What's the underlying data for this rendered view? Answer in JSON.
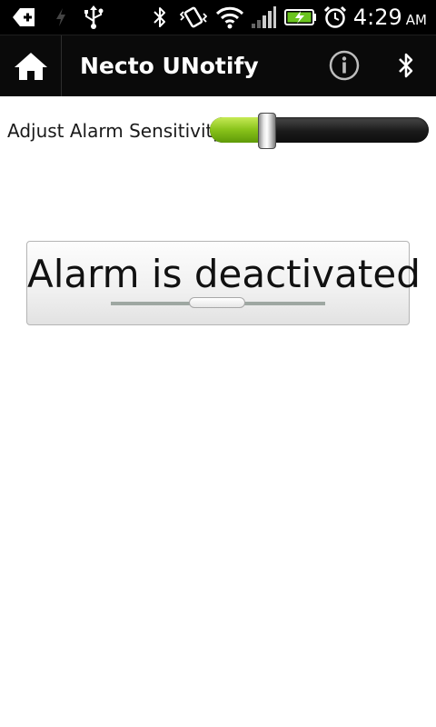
{
  "status_bar": {
    "time": "4:29",
    "ampm": "AM",
    "icons": [
      "add-notification-icon",
      "signal-off-icon",
      "usb-icon",
      "bluetooth-icon",
      "vibrate-icon",
      "wifi-icon",
      "cell-signal-icon",
      "battery-charging-icon",
      "alarm-clock-icon"
    ]
  },
  "action_bar": {
    "title": "Necto UNotify",
    "icons": [
      "home-icon",
      "info-icon",
      "bluetooth-icon"
    ]
  },
  "sensitivity": {
    "label": "Adjust Alarm Sensitivity",
    "level_fraction": 0.23,
    "fill_color": "#88c21a"
  },
  "alarm": {
    "label": "Alarm is deactivated",
    "state": "off"
  }
}
